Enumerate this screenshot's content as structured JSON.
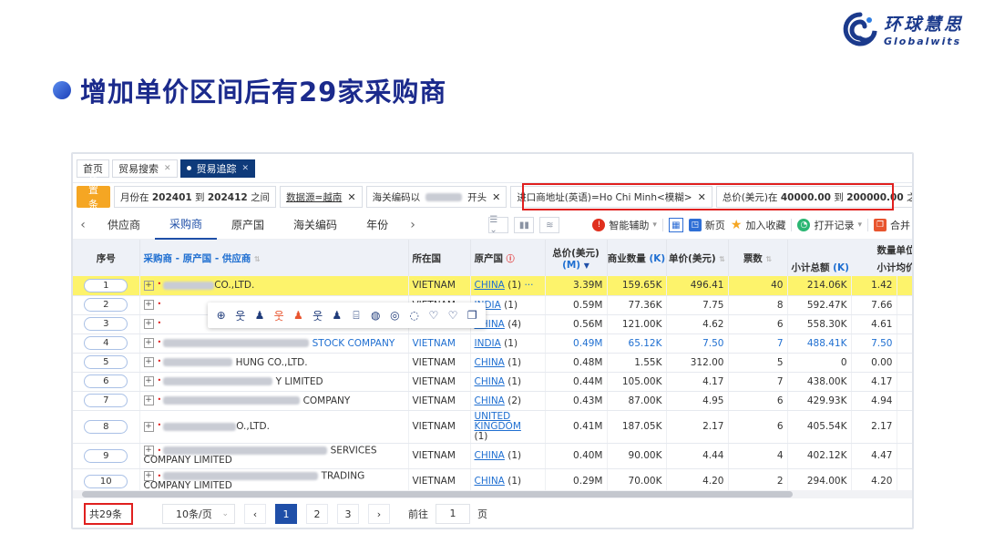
{
  "slide": {
    "title": "增加单价区间后有29家采购商",
    "logo_cn": "环球慧思",
    "logo_en": "Globalwits"
  },
  "tabs": [
    {
      "label": "首页"
    },
    {
      "label": "贸易搜索"
    },
    {
      "label": "贸易追踪"
    }
  ],
  "filters": {
    "cond_button": "设置条件",
    "chip1_pre": "月份在",
    "chip1_a": "202401",
    "chip1_mid": "到",
    "chip1_b": "202412",
    "chip1_post": "之间",
    "chip2": "数据源=越南",
    "chip3_pre": "海关编码以",
    "chip3_post": "开头",
    "chip4": "进口商地址(英语)=Ho Chi Minh<模糊>",
    "chip5_pre": "总价(美元)在",
    "chip5_a": "40000.00",
    "chip5_mid": "到",
    "chip5_b": "200000.00",
    "chip5_post": "之间"
  },
  "nav": {
    "items": [
      "供应商",
      "采购商",
      "原产国",
      "海关编码",
      "年份"
    ],
    "tools": {
      "assist": "智能辅助",
      "new_page": "新页",
      "add_fav": "加入收藏",
      "open_record": "打开记录",
      "merge": "合并"
    }
  },
  "table": {
    "headers": {
      "seq": "序号",
      "buyer": "采购商 - 原产国 - 供应商",
      "country": "所在国",
      "origin": "原产国",
      "total": "总价(美元)",
      "total_unit": "(M)",
      "qty": "商业数量",
      "qty_unit": "(K)",
      "unit_price": "单价(美元)",
      "count": "票数",
      "qty_unit_group": "数量单位",
      "subtotal": "小计总额",
      "subtotal_unit": "(K)",
      "sub_avg": "小计均价"
    },
    "rows": [
      {
        "seq": "1",
        "name": "CO.,LTD.",
        "country": "VIETNAM",
        "origin": "CHINA",
        "origin_n": "(1)",
        "total": "3.39M",
        "qty": "159.65K",
        "price": "496.41",
        "count": "40",
        "sub_total": "214.06K",
        "sub_avg": "1.42"
      },
      {
        "seq": "2",
        "name": "",
        "country": "VIETNAM",
        "origin": "INDIA",
        "origin_n": "(1)",
        "total": "0.59M",
        "qty": "77.36K",
        "price": "7.75",
        "count": "8",
        "sub_total": "592.47K",
        "sub_avg": "7.66"
      },
      {
        "seq": "3",
        "name": "",
        "country": "VIETNAM",
        "origin": "CHINA",
        "origin_n": "(4)",
        "total": "0.56M",
        "qty": "121.00K",
        "price": "4.62",
        "count": "6",
        "sub_total": "558.30K",
        "sub_avg": "4.61"
      },
      {
        "seq": "4",
        "name": "STOCK COMPANY",
        "country": "VIETNAM",
        "origin": "INDIA",
        "origin_n": "(1)",
        "total": "0.49M",
        "qty": "65.12K",
        "price": "7.50",
        "count": "7",
        "sub_total": "488.41K",
        "sub_avg": "7.50"
      },
      {
        "seq": "5",
        "name": "HUNG CO.,LTD.",
        "country": "VIETNAM",
        "origin": "CHINA",
        "origin_n": "(1)",
        "total": "0.48M",
        "qty": "1.55K",
        "price": "312.00",
        "count": "5",
        "sub_total": "0",
        "sub_avg": "0.00"
      },
      {
        "seq": "6",
        "name": "Y LIMITED",
        "country": "VIETNAM",
        "origin": "CHINA",
        "origin_n": "(1)",
        "total": "0.44M",
        "qty": "105.00K",
        "price": "4.17",
        "count": "7",
        "sub_total": "438.00K",
        "sub_avg": "4.17"
      },
      {
        "seq": "7",
        "name": "COMPANY",
        "country": "VIETNAM",
        "origin": "CHINA",
        "origin_n": "(2)",
        "total": "0.43M",
        "qty": "87.00K",
        "price": "4.95",
        "count": "6",
        "sub_total": "429.93K",
        "sub_avg": "4.94"
      },
      {
        "seq": "8",
        "name": "O.,LTD.",
        "country": "VIETNAM",
        "origin": "UNITED KINGDOM",
        "origin_n": "(1)",
        "total": "0.41M",
        "qty": "187.05K",
        "price": "2.17",
        "count": "6",
        "sub_total": "405.54K",
        "sub_avg": "2.17"
      },
      {
        "seq": "9",
        "name": "SERVICES",
        "name2": "COMPANY LIMITED",
        "country": "VIETNAM",
        "origin": "CHINA",
        "origin_n": "(1)",
        "total": "0.40M",
        "qty": "90.00K",
        "price": "4.44",
        "count": "4",
        "sub_total": "402.12K",
        "sub_avg": "4.47"
      },
      {
        "seq": "10",
        "name": "TRADING",
        "name2": "COMPANY LIMITED",
        "country": "VIETNAM",
        "origin": "CHINA",
        "origin_n": "(1)",
        "total": "0.29M",
        "qty": "70.00K",
        "price": "4.20",
        "count": "2",
        "sub_total": "294.00K",
        "sub_avg": "4.20"
      }
    ]
  },
  "pager": {
    "total": "共29条",
    "page_size": "10条/页",
    "pages": [
      "1",
      "2",
      "3"
    ],
    "goto_label": "前往",
    "goto_value": "1",
    "goto_suffix": "页"
  },
  "colors": {
    "title": "#1b2a8c",
    "highlight_row": "#fdf36b",
    "red_box": "#e0201f",
    "accent": "#1f4fa8",
    "cond_button": "#f5a623"
  }
}
